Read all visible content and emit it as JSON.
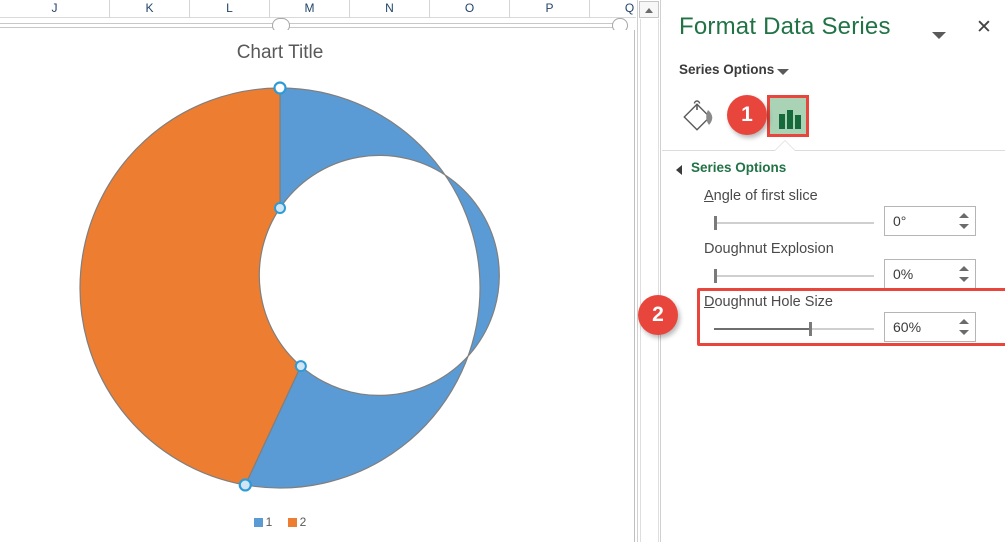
{
  "worksheet": {
    "column_headers": [
      "J",
      "K",
      "L",
      "M",
      "N",
      "O",
      "P",
      "Q"
    ],
    "hscrollbar": {
      "name": "horizontal-scrollbar"
    },
    "vscrollbar": {
      "name": "vertical-scrollbar",
      "up_arrow": "scroll-up-arrow"
    }
  },
  "chart": {
    "title": "Chart Title",
    "legend": [
      {
        "label": "1",
        "color": "#5B9BD5"
      },
      {
        "label": "2",
        "color": "#ED7D31"
      }
    ],
    "selected": true
  },
  "chart_data": {
    "type": "pie",
    "variant": "doughnut",
    "title": "Chart Title",
    "hole_size_pct": 60,
    "first_slice_angle_deg": 0,
    "explosion_pct": 0,
    "categories": [
      "1",
      "2"
    ],
    "values": [
      53,
      47
    ],
    "slices": [
      {
        "name": "1",
        "value": 53,
        "color": "#5B9BD5",
        "start_angle_deg": 0,
        "end_angle_deg": 190
      },
      {
        "name": "2",
        "value": 47,
        "color": "#ED7D31",
        "start_angle_deg": 190,
        "end_angle_deg": 360
      }
    ],
    "legend_position": "bottom",
    "grid": false,
    "xlabel": "",
    "ylabel": ""
  },
  "pane": {
    "title": "Format Data Series",
    "dropdown_icon": "chevron-down-icon",
    "close_icon": "close-icon",
    "subhead": "Series Options",
    "subhead_icon": "chevron-down-icon",
    "tabs": [
      {
        "name": "fill-and-line",
        "icon": "paint-bucket-icon",
        "active": false
      },
      {
        "name": "series-options",
        "icon": "bar-chart-icon",
        "active": true
      }
    ],
    "section_title": "Series Options",
    "section_icon": "triangle-collapse-icon",
    "fields": [
      {
        "label_prefix": "A",
        "label_rest": "ngle of first slice",
        "value": "0°",
        "slider_pct": 0,
        "highlighted": false
      },
      {
        "label_prefix": "",
        "label_rest": "Doughnut Explosion",
        "value": "0%",
        "slider_pct": 0,
        "highlighted": false
      },
      {
        "label_prefix": "D",
        "label_rest": "oughnut Hole Size",
        "value": "60%",
        "slider_pct": 60,
        "highlighted": true
      }
    ]
  },
  "annotations": [
    {
      "name": "callout-badge-1",
      "label": "1"
    },
    {
      "name": "callout-badge-2",
      "label": "2"
    }
  ],
  "colors": {
    "excel_green": "#217346",
    "highlight_red": "#E8453C",
    "series1": "#5B9BD5",
    "series2": "#ED7D31",
    "header_text": "#22456b"
  }
}
